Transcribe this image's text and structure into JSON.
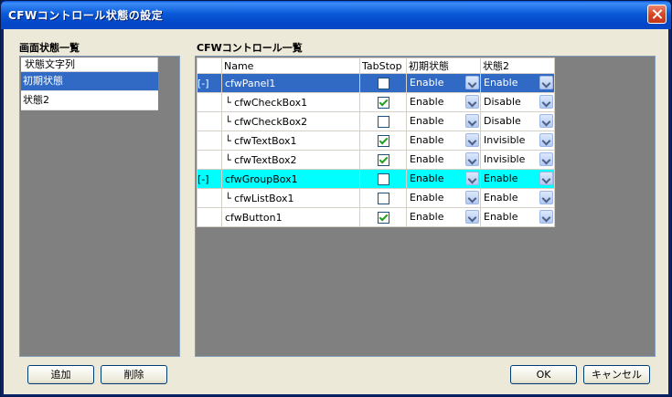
{
  "window": {
    "title": "CFWコントロール状態の設定"
  },
  "left": {
    "label": "画面状態一覧",
    "column_header": "状態文字列",
    "items": [
      {
        "label": "初期状態",
        "selected": true
      },
      {
        "label": "状態2",
        "selected": false
      }
    ]
  },
  "grid": {
    "label": "CFWコントロール一覧",
    "headers": {
      "name": "Name",
      "tabstop": "TabStop",
      "state1": "初期状態",
      "state2": "状態2"
    },
    "rows": [
      {
        "expander": "[-]",
        "name": "cfwPanel1",
        "tree": "",
        "tabstop": false,
        "state1": "Enable",
        "state2": "Enable",
        "highlight": "blue"
      },
      {
        "expander": "",
        "name": "cfwCheckBox1",
        "tree": "└",
        "tabstop": true,
        "state1": "Enable",
        "state2": "Disable",
        "highlight": ""
      },
      {
        "expander": "",
        "name": "cfwCheckBox2",
        "tree": "└",
        "tabstop": false,
        "state1": "Enable",
        "state2": "Disable",
        "highlight": ""
      },
      {
        "expander": "",
        "name": "cfwTextBox1",
        "tree": "└",
        "tabstop": true,
        "state1": "Enable",
        "state2": "Invisible",
        "highlight": ""
      },
      {
        "expander": "",
        "name": "cfwTextBox2",
        "tree": "└",
        "tabstop": true,
        "state1": "Enable",
        "state2": "Invisible",
        "highlight": ""
      },
      {
        "expander": "[-]",
        "name": "cfwGroupBox1",
        "tree": "",
        "tabstop": false,
        "state1": "Enable",
        "state2": "Enable",
        "highlight": "cyan"
      },
      {
        "expander": "",
        "name": "cfwListBox1",
        "tree": "└",
        "tabstop": false,
        "state1": "Enable",
        "state2": "Enable",
        "highlight": ""
      },
      {
        "expander": "",
        "name": "cfwButton1",
        "tree": "",
        "tabstop": true,
        "state1": "Enable",
        "state2": "Enable",
        "highlight": ""
      }
    ]
  },
  "buttons": {
    "add": "追加",
    "delete": "削除",
    "ok": "OK",
    "cancel": "キャンセル"
  },
  "colors": {
    "selection_blue": "#316ac5",
    "highlight_cyan": "#00ffff",
    "panel_gray": "#808080"
  }
}
